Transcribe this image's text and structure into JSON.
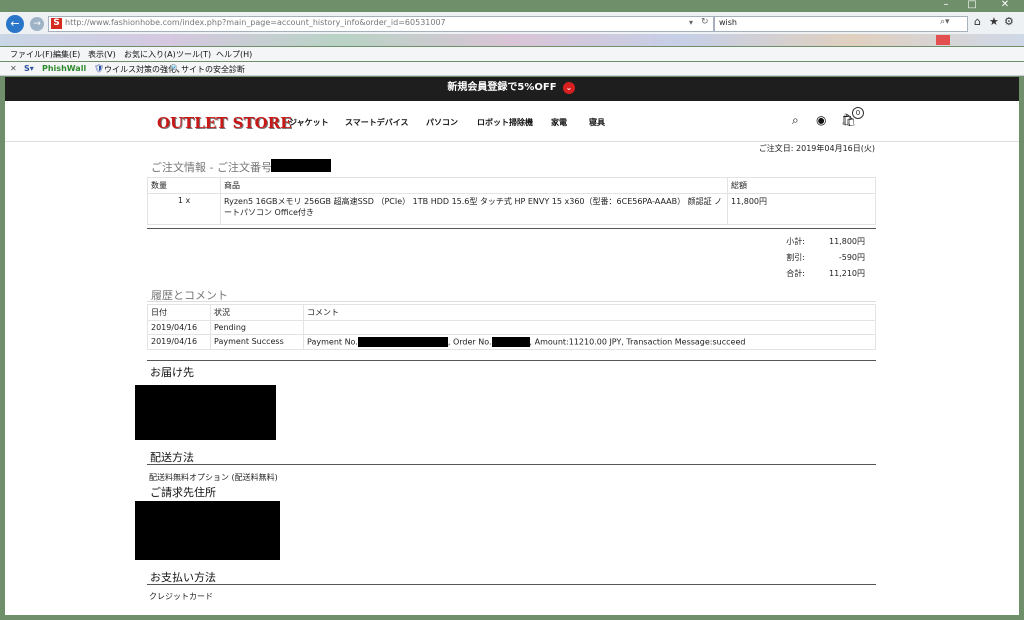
{
  "browser": {
    "url": "http://www.fashionhobe.com/index.php?main_page=account_history_info&order_id=60531007",
    "search_value": "wish",
    "menu": [
      "ファイル(F)",
      "編集(E)",
      "表示(V)",
      "お気に入り(A)",
      "ツール(T)",
      "ヘルプ(H)"
    ],
    "toolbar": {
      "close": "✕",
      "phishwall": "PhishWall",
      "virus": "ウイルス対策の強化",
      "sitecheck": "サイトの安全診断"
    }
  },
  "promo": {
    "text": "新規会員登録で5%OFF"
  },
  "header": {
    "logo": "OUTLET STORE",
    "nav": [
      "ジャケット",
      "スマートデバイス",
      "パソコン",
      "ロボット掃除機",
      "家電",
      "寝具"
    ],
    "cart_count": "0"
  },
  "order": {
    "date": "ご注文日: 2019年04月16日(火)",
    "title": "ご注文情報 - ご注文番号 #",
    "columns": [
      "数量",
      "商品",
      "総額"
    ],
    "item": {
      "qty": "1 x",
      "name": "Ryzen5 16GBメモリ 256GB 超高速SSD （PCIe） 1TB HDD 15.6型 タッチ式 HP ENVY 15 x360（型番：6CE56PA-AAAB） 颜認証 ノートパソコン Office付き",
      "total": "11,800円"
    },
    "summary": [
      {
        "label": "小計:",
        "value": "11,800円"
      },
      {
        "label": "割引:",
        "value": "-590円"
      },
      {
        "label": "合計:",
        "value": "11,210円"
      }
    ]
  },
  "history": {
    "title": "履歴とコメント",
    "columns": [
      "日付",
      "状況",
      "コメント"
    ],
    "rows": [
      {
        "date": "2019/04/16",
        "status": "Pending",
        "comment_a": "",
        "comment_b": "",
        "comment_c": ""
      },
      {
        "date": "2019/04/16",
        "status": "Payment Success",
        "comment_a": "Payment No.",
        "comment_b": ", Order No.",
        "comment_c": ", Amount:11210.00 JPY, Transaction Message:succeed"
      }
    ]
  },
  "delivery": {
    "title": "お届け先"
  },
  "shipping": {
    "title": "配送方法",
    "value": "配送料無料オプション (配送料無料)"
  },
  "billing": {
    "title": "ご請求先住所"
  },
  "payment": {
    "title": "お支払い方法",
    "value": "クレジットカード"
  }
}
